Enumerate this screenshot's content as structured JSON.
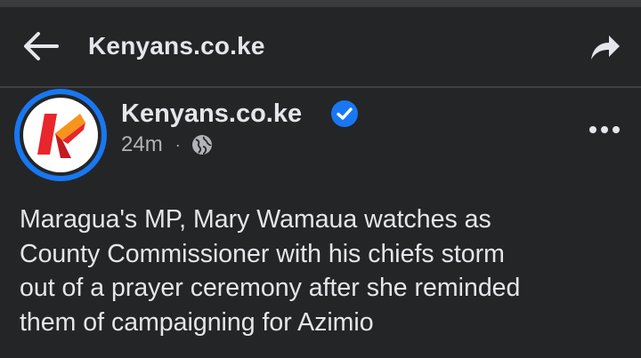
{
  "header": {
    "title": "Kenyans.co.ke",
    "back_icon": "arrow-left-icon",
    "share_icon": "share-arrow-icon"
  },
  "post": {
    "author": "Kenyans.co.ke",
    "verified_icon": "verified-badge-icon",
    "time": "24m",
    "separator": "·",
    "audience_icon": "globe-icon",
    "more_icon": "more-horizontal-icon",
    "text_lines": [
      "Maragua's MP, Mary Wamaua watches as",
      "County Commissioner with his chiefs storm",
      "out of a prayer ceremony after she reminded",
      "them of campaigning for Azimio"
    ]
  },
  "colors": {
    "background": "#242526",
    "text_primary": "#e4e6eb",
    "text_secondary": "#b0b3b8",
    "accent_blue": "#1877f2",
    "logo_red": "#e8262b",
    "logo_orange": "#f7941d"
  }
}
